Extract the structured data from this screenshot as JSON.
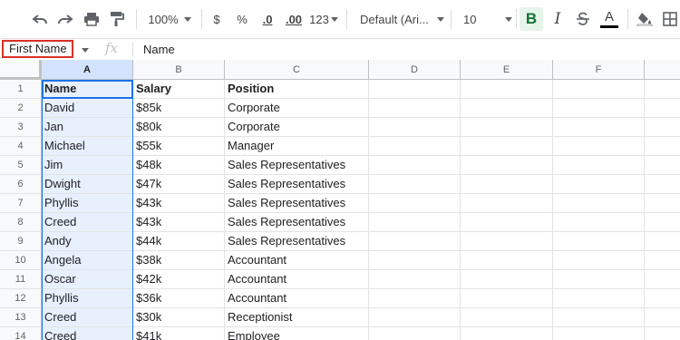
{
  "toolbar": {
    "zoom": "100%",
    "currency": "$",
    "percent": "%",
    "decrease_decimal": ".0",
    "increase_decimal": ".00",
    "more_formats": "123",
    "font": "Default (Ari...",
    "font_size": "10",
    "bold": "B",
    "italic": "I",
    "text_color_letter": "A",
    "text_color_bar": "#000000",
    "bold_active_bg": "#e6f4ea"
  },
  "formula_bar": {
    "name_box": "First Name",
    "fx": "fx",
    "value": "Name"
  },
  "sheet": {
    "columns": [
      "A",
      "B",
      "C",
      "D",
      "E",
      "F"
    ],
    "selected_column": "A",
    "rows": [
      {
        "n": "1",
        "a": "Name",
        "b": "Salary",
        "c": "Position"
      },
      {
        "n": "2",
        "a": "David",
        "b": "$85k",
        "c": "Corporate"
      },
      {
        "n": "3",
        "a": "Jan",
        "b": "$80k",
        "c": "Corporate"
      },
      {
        "n": "4",
        "a": "Michael",
        "b": "$55k",
        "c": "Manager"
      },
      {
        "n": "5",
        "a": "Jim",
        "b": "$48k",
        "c": "Sales Representatives"
      },
      {
        "n": "6",
        "a": "Dwight",
        "b": "$47k",
        "c": "Sales Representatives"
      },
      {
        "n": "7",
        "a": "Phyllis",
        "b": "$43k",
        "c": "Sales Representatives"
      },
      {
        "n": "8",
        "a": "Creed",
        "b": "$43k",
        "c": "Sales Representatives"
      },
      {
        "n": "9",
        "a": "Andy",
        "b": "$44k",
        "c": "Sales Representatives"
      },
      {
        "n": "10",
        "a": "Angela",
        "b": "$38k",
        "c": "Accountant"
      },
      {
        "n": "11",
        "a": "Oscar",
        "b": "$42k",
        "c": "Accountant"
      },
      {
        "n": "12",
        "a": "Phyllis",
        "b": "$36k",
        "c": "Accountant"
      },
      {
        "n": "13",
        "a": "Creed",
        "b": "$30k",
        "c": "Receptionist"
      },
      {
        "n": "14",
        "a": "Creed",
        "b": "$41k",
        "c": "Employee"
      }
    ]
  }
}
